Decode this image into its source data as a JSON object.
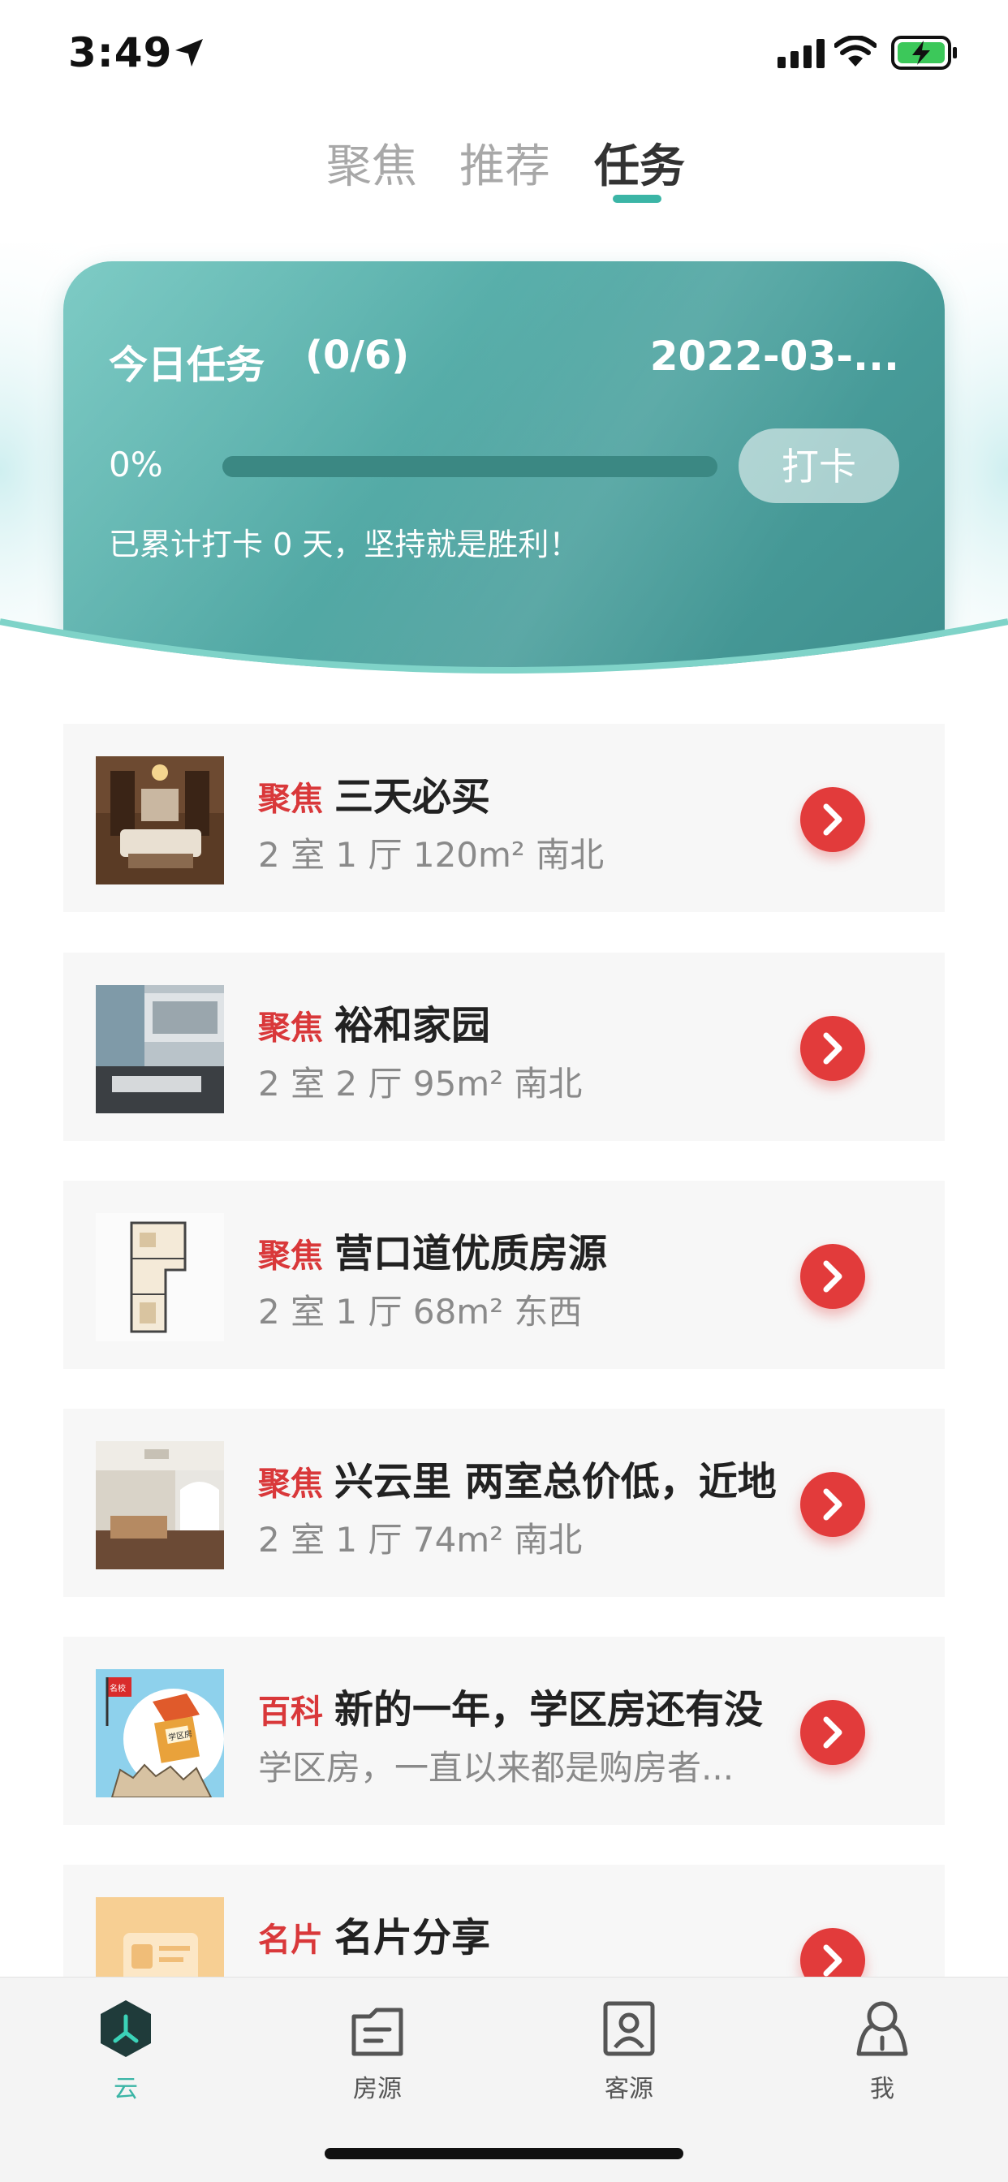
{
  "status": {
    "time": "3:49"
  },
  "tabs": [
    "聚焦",
    "推荐",
    "任务"
  ],
  "active_tab": 2,
  "task": {
    "title": "今日任务",
    "count": "(0/6)",
    "date": "2022-03-...",
    "percent_label": "0%",
    "progress": 0,
    "checkin_label": "打卡",
    "streak_text": "已累计打卡 0 天，坚持就是胜利！"
  },
  "items": [
    {
      "tag": "聚焦",
      "title": "三天必买",
      "subtitle": "2 室 1 厅 120m² 南北"
    },
    {
      "tag": "聚焦",
      "title": "裕和家园",
      "subtitle": "2 室 2 厅 95m² 南北"
    },
    {
      "tag": "聚焦",
      "title": "营口道优质房源",
      "subtitle": "2 室 1 厅 68m² 东西"
    },
    {
      "tag": "聚焦",
      "title": "兴云里 两室总价低，近地",
      "subtitle": "2 室 1 厅 74m² 南北"
    },
    {
      "tag": "百科",
      "title": "新的一年，学区房还有没",
      "subtitle": "学区房，一直以来都是购房者..."
    },
    {
      "tag": "名片",
      "title": "名片分享",
      "subtitle": ""
    }
  ],
  "thumb_labels": {
    "school_sign": "学区房",
    "flag": "名校"
  },
  "tabbar": [
    "云",
    "房源",
    "客源",
    "我"
  ],
  "colors": {
    "accent": "#3bb5a6",
    "tag_red": "#d9383a",
    "button_red": "#e23b3b"
  }
}
